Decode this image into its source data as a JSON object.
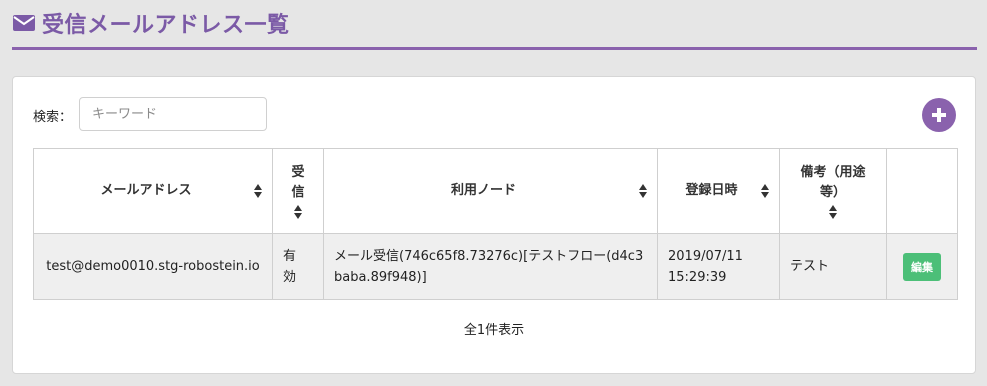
{
  "header": {
    "title": "受信メールアドレス一覧",
    "icon": "envelope-icon",
    "accent_color": "#8a62ad"
  },
  "search": {
    "label": "検索：",
    "placeholder": "キーワード",
    "value": ""
  },
  "toolbar": {
    "add_icon": "plus-icon"
  },
  "table": {
    "columns": [
      {
        "label": "メールアドレス"
      },
      {
        "label_line1": "受",
        "label_line2": "信"
      },
      {
        "label": "利用ノード"
      },
      {
        "label": "登録日時"
      },
      {
        "label_line1": "備考（用途",
        "label_line2": "等）"
      },
      {
        "label": ""
      }
    ],
    "rows": [
      {
        "email": "test@demo0010.stg-robostein.io",
        "receive_line1": "有",
        "receive_line2": "効",
        "node": "メール受信(746c65f8.73276c)[テストフロー(d4c3baba.89f948)]",
        "registered": "2019/07/11 15:29:39",
        "note": "テスト",
        "edit_label": "編集",
        "edit_color": "#4cbf78"
      }
    ]
  },
  "footer": {
    "count_text": "全1件表示"
  }
}
